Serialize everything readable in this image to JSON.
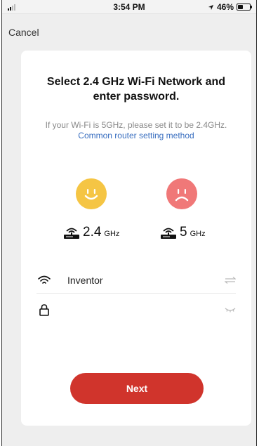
{
  "status_bar": {
    "time": "3:54 PM",
    "battery_text": "46%",
    "battery_level": 0.46
  },
  "nav": {
    "cancel_label": "Cancel"
  },
  "card": {
    "title": "Select 2.4 GHz Wi-Fi Network and enter password.",
    "subtitle_text": "If your Wi-Fi is 5GHz, please set it to be 2.4GHz.",
    "subtitle_link": "Common router setting method",
    "band_24": {
      "number": "2.4",
      "unit": "GHz",
      "icon": "router-icon",
      "face": "happy-face-icon",
      "color": "#f5c544"
    },
    "band_5": {
      "number": "5",
      "unit": "GHz",
      "icon": "router-icon",
      "face": "sad-face-icon",
      "color": "#f07878"
    },
    "wifi_field": {
      "value": "Inventor",
      "icon": "wifi-icon",
      "action_icon": "switch-network-icon"
    },
    "password_field": {
      "value": "",
      "placeholder": "",
      "icon": "lock-icon",
      "action_icon": "eye-closed-icon"
    },
    "next_label": "Next"
  },
  "colors": {
    "accent": "#d0342c",
    "link": "#3a6fc0",
    "background": "#eeeeee"
  }
}
